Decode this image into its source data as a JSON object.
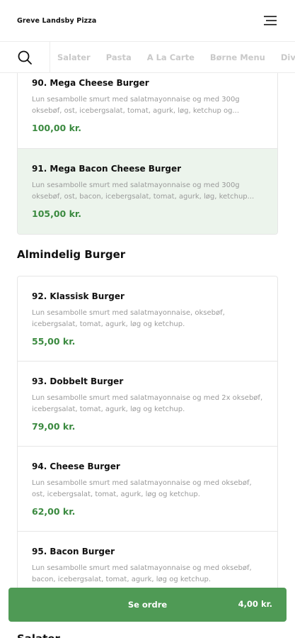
{
  "header": {
    "brand": "Greve Landsby Pizza"
  },
  "categories": [
    "Salater",
    "Pasta",
    "A La Carte",
    "Børne Menu",
    "Diverse"
  ],
  "groups": [
    {
      "items": [
        {
          "name": "90. Mega Cheese Burger",
          "desc": "Lun sesambolle smurt med salatmayonnaise og med 300g oksebøf, ost, icebergsalat, tomat, agurk, løg, ketchup og...",
          "price": "100,00 kr."
        },
        {
          "name": "91. Mega Bacon Cheese Burger",
          "desc": "Lun sesambolle smurt med salatmayonnaise og med 300g oksebøf, ost, bacon, icebergsalat, tomat, agurk, løg, ketchup...",
          "price": "105,00 kr."
        }
      ]
    },
    {
      "title": "Almindelig Burger",
      "items": [
        {
          "name": "92. Klassisk Burger",
          "desc": "Lun sesambolle smurt med salatmayonnaise, oksebøf, icebergsalat, tomat, agurk, løg og ketchup.",
          "price": "55,00 kr."
        },
        {
          "name": "93. Dobbelt Burger",
          "desc": "Lun sesambolle smurt med salatmayonnaise og med 2x oksebøf, icebergsalat, tomat, agurk, løg og ketchup.",
          "price": "79,00 kr."
        },
        {
          "name": "94. Cheese Burger",
          "desc": "Lun sesambolle smurt med salatmayonnaise og med oksebøf, ost, icebergsalat, tomat, agurk, løg og ketchup.",
          "price": "62,00 kr."
        },
        {
          "name": "95. Bacon Burger",
          "desc": "Lun sesambolle smurt med salatmayonnaise og med oksebøf, bacon, icebergsalat, tomat, agurk, løg og ketchup.",
          "price": ""
        }
      ]
    }
  ],
  "next_section": {
    "title": "Salater"
  },
  "order": {
    "label": "Se ordre",
    "total": "4,00 kr."
  },
  "colors": {
    "accent": "#4f9a55",
    "price": "#3b8a40",
    "highlight": "#ecf4ec"
  }
}
